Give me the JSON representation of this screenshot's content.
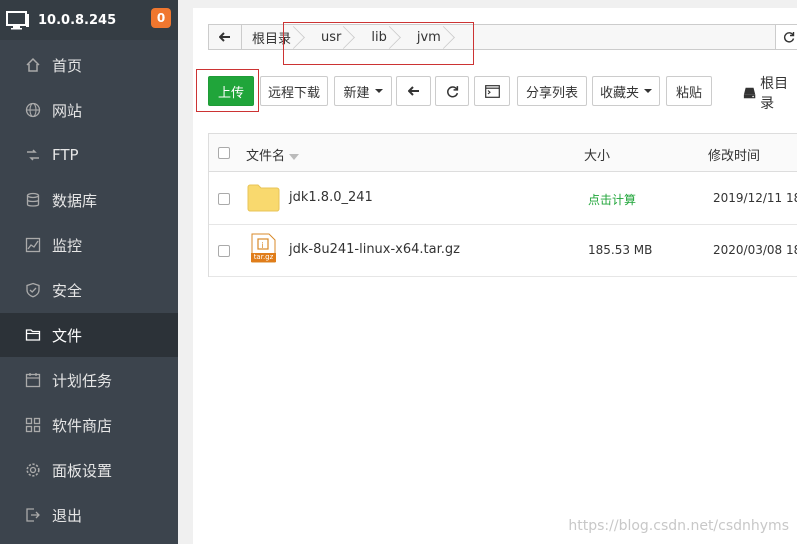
{
  "sidebar": {
    "host": "10.0.8.245",
    "badge": "0",
    "items": [
      {
        "label": "首页",
        "icon": "home-icon"
      },
      {
        "label": "网站",
        "icon": "globe-icon"
      },
      {
        "label": "FTP",
        "icon": "ftp-icon"
      },
      {
        "label": "数据库",
        "icon": "database-icon"
      },
      {
        "label": "监控",
        "icon": "monitor-icon"
      },
      {
        "label": "安全",
        "icon": "shield-icon"
      },
      {
        "label": "文件",
        "icon": "folder-icon"
      },
      {
        "label": "计划任务",
        "icon": "calendar-icon"
      },
      {
        "label": "软件商店",
        "icon": "apps-icon"
      },
      {
        "label": "面板设置",
        "icon": "gear-icon"
      },
      {
        "label": "退出",
        "icon": "logout-icon"
      }
    ],
    "active_index": 6
  },
  "path": {
    "crumbs": [
      "根目录",
      "usr",
      "lib",
      "jvm"
    ]
  },
  "toolbar": {
    "upload": "上传",
    "remote_download": "远程下载",
    "new": "新建",
    "share_list": "分享列表",
    "favorites": "收藏夹",
    "paste": "粘贴",
    "disk": "根目录"
  },
  "table": {
    "headers": {
      "name": "文件名",
      "size": "大小",
      "modified": "修改时间"
    },
    "rows": [
      {
        "name": "jdk1.8.0_241",
        "size": "点击计算",
        "modified": "2019/12/11 18",
        "type": "folder"
      },
      {
        "name": "jdk-8u241-linux-x64.tar.gz",
        "size": "185.53 MB",
        "modified": "2020/03/08 18",
        "type": "tar.gz"
      }
    ]
  },
  "file_icon_label": "tar.gz",
  "watermark": "https://blog.csdn.net/csdnhyms",
  "colors": {
    "sidebar": "#3c444d",
    "active": "#2c3238",
    "primary": "#20a53a",
    "badge": "#f0772f",
    "calc_link": "#20a53a",
    "highlight": "#cc3333"
  }
}
